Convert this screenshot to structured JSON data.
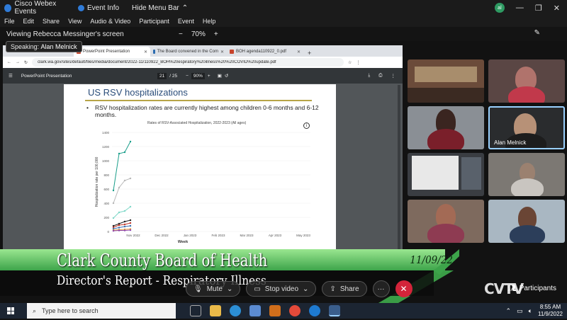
{
  "titlebar": {
    "app_title": "Cisco Webex Events",
    "event_info": "Event Info",
    "hide_menu_bar": "Hide Menu Bar",
    "avatar_initials": "al"
  },
  "menu": [
    "File",
    "Edit",
    "Share",
    "View",
    "Audio & Video",
    "Participant",
    "Event",
    "Help"
  ],
  "share_bar": {
    "viewing_label": "Viewing Rebecca Messinger's screen",
    "zoom_minus": "−",
    "zoom_level": "70%",
    "zoom_plus": "+"
  },
  "speaking": {
    "prefix": "Speaking:",
    "name": "Alan Melnick"
  },
  "browser": {
    "tabs": [
      {
        "label": "PowerPoint Presentation",
        "active": true
      },
      {
        "label": "The Board convened in the Com",
        "active": false
      },
      {
        "label": "BOH agenda110922_0.pdf",
        "active": false
      }
    ],
    "url": "clark.wa.gov/sites/default/files/media/document/2022-11/110922_BOH%20espiratory%20illness%20%20COVID%20update.pdf",
    "pdf_title": "PowerPoint Presentation",
    "page_current": "21",
    "page_total": "/ 25",
    "zoom": "90%"
  },
  "slide": {
    "title": "US RSV hospitalizations",
    "bullet": "RSV hospitalization rates are currently highest among children 0-6 months and 6-12 months.",
    "info_glyph": "i"
  },
  "chart_data": {
    "type": "line",
    "title": "Rates of RSV-Associated Hospitalization, 2022-2023 (All ages)",
    "xlabel": "Week",
    "ylabel": "Hospitalization rate per 100,000",
    "ylim": [
      0,
      1400
    ],
    "yticks": [
      "0",
      "200",
      "400",
      "600",
      "800",
      "1000",
      "1200",
      "1400"
    ],
    "xticks": [
      "Nov 2022",
      "Dec 2022",
      "Jan 2023",
      "Feb 2023",
      "Mar 2023",
      "Apr 2023",
      "May 2023"
    ],
    "x": [
      0,
      1,
      2,
      3,
      4
    ],
    "series": [
      {
        "values": [
          580,
          1100,
          1120,
          1270
        ],
        "color": "#1a9e8a"
      },
      {
        "values": [
          400,
          620,
          720,
          750
        ],
        "color": "#b8b8b8"
      },
      {
        "values": [
          190,
          270,
          290,
          350
        ],
        "color": "#7fd8c8"
      },
      {
        "values": [
          80,
          110,
          140,
          160
        ],
        "color": "#222222"
      },
      {
        "values": [
          60,
          90,
          100,
          120
        ],
        "color": "#c0392b"
      },
      {
        "values": [
          40,
          55,
          70,
          80
        ],
        "color": "#3a6fb0"
      },
      {
        "values": [
          20,
          25,
          30,
          35
        ],
        "color": "#e3a13b"
      },
      {
        "values": [
          10,
          15,
          15,
          20
        ],
        "color": "#8e44ad"
      }
    ]
  },
  "videos": [
    {
      "name": ""
    },
    {
      "name": ""
    },
    {
      "name": ""
    },
    {
      "name": "Alan Melnick"
    },
    {
      "name": ""
    },
    {
      "name": ""
    },
    {
      "name": ""
    },
    {
      "name": ""
    }
  ],
  "lower_third": {
    "line1": "Clark County Board of Health",
    "line2": "Director's Report - Respiratory Illness",
    "date": "11/09/22"
  },
  "controls": {
    "mute": "Mute",
    "stop_video": "Stop video",
    "share": "Share",
    "more": "···",
    "participants": "Participants",
    "cvtv": "CVTV"
  },
  "taskbar": {
    "search_placeholder": "Type here to search",
    "time": "8:55 AM",
    "date": "11/9/2022"
  },
  "colors": {
    "lower_third_green": "#3da44a",
    "end_button": "#d3243a",
    "active_speaker_border": "#9ad1ff"
  }
}
